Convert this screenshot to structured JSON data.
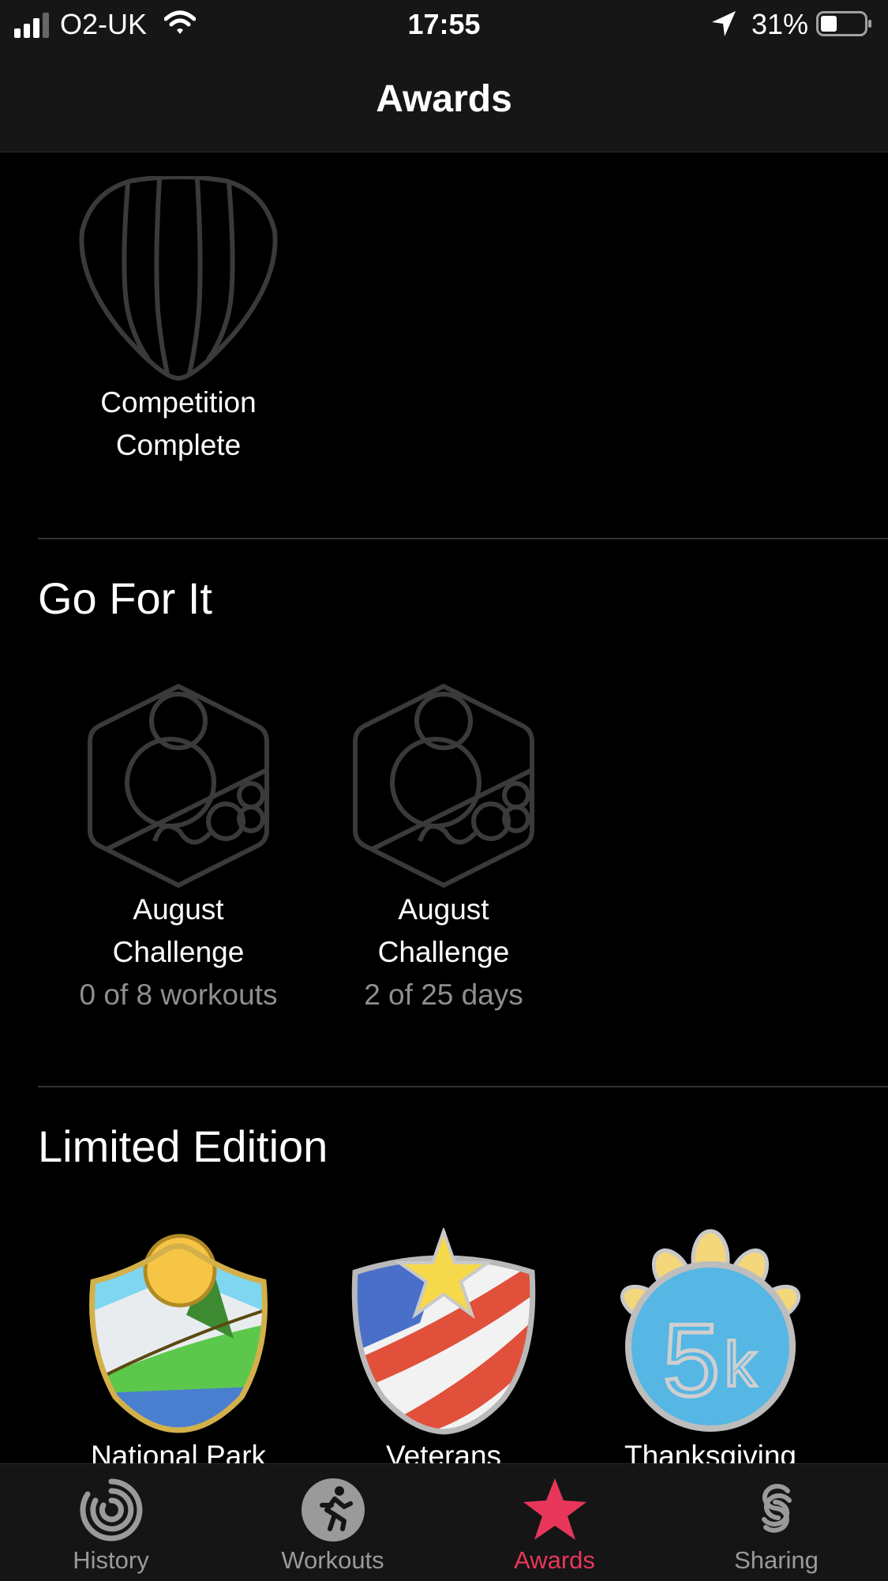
{
  "status_bar": {
    "carrier": "O2-UK",
    "time": "17:55",
    "battery": "31%"
  },
  "nav": {
    "title": "Awards"
  },
  "top_award": {
    "label_line1": "Competition",
    "label_line2": "Complete"
  },
  "sections": [
    {
      "title": "Go For It",
      "awards": [
        {
          "label_line1": "August",
          "label_line2": "Challenge",
          "progress": "0 of 8 workouts"
        },
        {
          "label_line1": "August",
          "label_line2": "Challenge",
          "progress": "2 of 25 days"
        }
      ]
    },
    {
      "title": "Limited Edition",
      "awards": [
        {
          "label_line1": "National Park"
        },
        {
          "label_line1": "Veterans"
        },
        {
          "label_line1": "Thanksgiving"
        }
      ]
    }
  ],
  "tabs": [
    {
      "label": "History",
      "icon": "activity-rings-icon"
    },
    {
      "label": "Workouts",
      "icon": "runner-icon"
    },
    {
      "label": "Awards",
      "icon": "star-icon",
      "active": true
    },
    {
      "label": "Sharing",
      "icon": "sharing-icon"
    }
  ],
  "colors": {
    "accent": "#e8365a",
    "badge_outline": "#3a3a3a"
  }
}
